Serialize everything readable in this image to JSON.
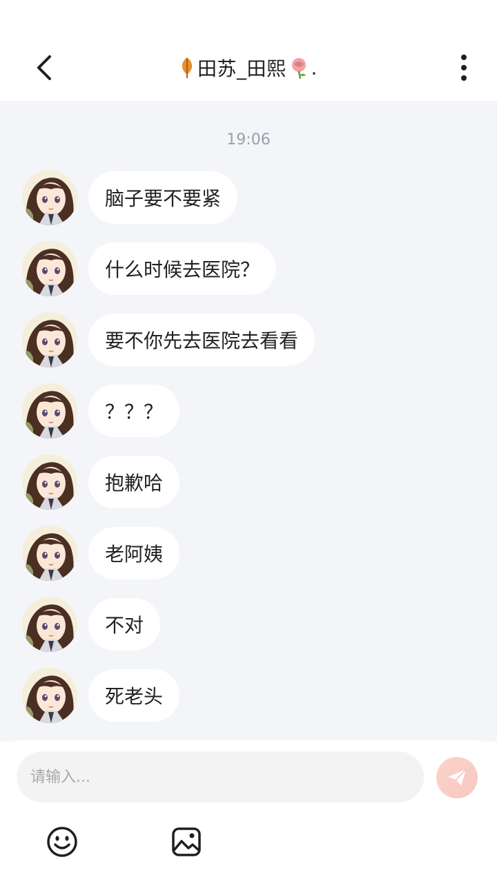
{
  "header": {
    "title": "田苏_田熙",
    "title_suffix": ".",
    "back_icon": "chevron-left-icon",
    "more_icon": "more-vertical-icon"
  },
  "chat": {
    "timestamp": "19:06",
    "messages": [
      {
        "text": "脑子要不要紧"
      },
      {
        "text": "什么时候去医院？"
      },
      {
        "text": "要不你先去医院去看看"
      },
      {
        "text": "？？？"
      },
      {
        "text": "抱歉哈"
      },
      {
        "text": "老阿姨"
      },
      {
        "text": "不对"
      },
      {
        "text": "死老头"
      }
    ]
  },
  "input": {
    "placeholder": "请输入...",
    "value": ""
  },
  "toolbar": {
    "emoji_icon": "smiley-icon",
    "image_icon": "image-icon",
    "send_icon": "send-icon"
  },
  "colors": {
    "chat_background": "#f3f5f8",
    "bubble": "#ffffff",
    "send_button": "#f7c7c2",
    "timestamp": "#9aa0a8"
  }
}
